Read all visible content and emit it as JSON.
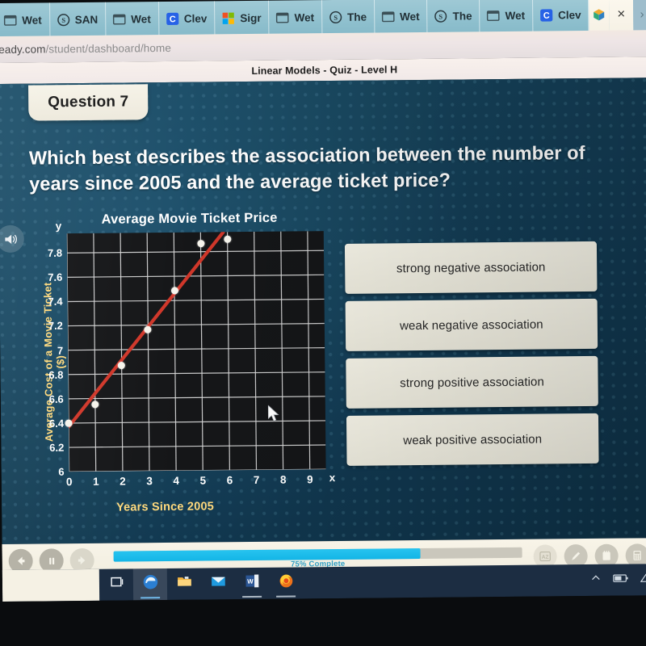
{
  "browser": {
    "tabs": [
      {
        "label": "Wet",
        "icon": "window-icon"
      },
      {
        "label": "SAN",
        "icon": "s-circle-icon"
      },
      {
        "label": "Wet",
        "icon": "window-icon"
      },
      {
        "label": "Clev",
        "icon": "clever-c-icon"
      },
      {
        "label": "Sigr",
        "icon": "microsoft-squares-icon"
      },
      {
        "label": "Wet",
        "icon": "window-icon"
      },
      {
        "label": "The",
        "icon": "s-circle-icon"
      },
      {
        "label": "Wet",
        "icon": "window-icon"
      },
      {
        "label": "The",
        "icon": "s-circle-icon"
      },
      {
        "label": "Wet",
        "icon": "window-icon"
      },
      {
        "label": "Clev",
        "icon": "clever-c-icon"
      }
    ],
    "active_tab": {
      "label": "",
      "icon": "cube-icon"
    },
    "close_label": "×",
    "scroll_right_label": "›",
    "url_prefix": "ready.com",
    "url_path": "/student/dashboard/home"
  },
  "page": {
    "title": "Linear Models - Quiz - Level H",
    "question_badge": "Question 7",
    "question_text": "Which best describes the association between the number of years since 2005 and the average ticket price?",
    "speaker_icon": "audio-speaker-icon"
  },
  "chart_data": {
    "type": "scatter",
    "title": "Average Movie Ticket Price",
    "xlabel": "Years Since 2005",
    "ylabel": "Average Cost of a Movie Ticket ($)",
    "x_axis_letter": "x",
    "y_axis_letter": "y",
    "xlim": [
      0,
      9.6
    ],
    "ylim": [
      6,
      7.96
    ],
    "xticks": [
      "0",
      "1",
      "2",
      "3",
      "4",
      "5",
      "6",
      "7",
      "8",
      "9"
    ],
    "xtick_values": [
      0,
      1,
      2,
      3,
      4,
      5,
      6,
      7,
      8,
      9
    ],
    "yticks": [
      "6",
      "6.2",
      "6.4",
      "6.6",
      "6.8",
      "7",
      "7.2",
      "7.4",
      "7.6",
      "7.8"
    ],
    "ytick_values": [
      6,
      6.2,
      6.4,
      6.6,
      6.8,
      7,
      7.2,
      7.4,
      7.6,
      7.8
    ],
    "grid": true,
    "legend": "none",
    "plot_background": "#17181a",
    "grid_color": "#d8d8d8",
    "point_color": "#f4f2ea",
    "trendline_color": "#d2372a",
    "x": [
      0,
      1,
      2,
      3,
      4,
      5,
      6
    ],
    "y": [
      6.4,
      6.55,
      6.87,
      7.16,
      7.48,
      7.87,
      7.9
    ],
    "points": [
      {
        "x": 0,
        "y": 6.4
      },
      {
        "x": 1,
        "y": 6.55
      },
      {
        "x": 2,
        "y": 6.87
      },
      {
        "x": 3,
        "y": 7.16
      },
      {
        "x": 4,
        "y": 7.48
      },
      {
        "x": 5,
        "y": 7.87
      },
      {
        "x": 6,
        "y": 7.9
      }
    ],
    "trendline": {
      "x0": 0,
      "y0": 6.37,
      "x1": 5.85,
      "y1": 7.96
    }
  },
  "answers": {
    "options": [
      {
        "label": "strong negative association"
      },
      {
        "label": "weak negative association"
      },
      {
        "label": "strong positive association"
      },
      {
        "label": "weak positive association"
      }
    ]
  },
  "toolbar": {
    "back_icon": "back-arrow-icon",
    "pause_icon": "pause-icon",
    "forward_icon": "forward-arrow-icon",
    "progress_percent": 75,
    "progress_text": "75% Complete",
    "tools": [
      {
        "icon": "glossary-az-icon",
        "enabled": false
      },
      {
        "icon": "pencil-icon",
        "enabled": true
      },
      {
        "icon": "notepad-icon",
        "enabled": true
      },
      {
        "icon": "calculator-icon",
        "enabled": true
      }
    ]
  },
  "taskbar": {
    "items": [
      {
        "icon": "task-view-icon",
        "active": false
      },
      {
        "icon": "edge-browser-icon",
        "active": true
      },
      {
        "icon": "file-explorer-icon",
        "active": false
      },
      {
        "icon": "mail-icon",
        "active": false
      },
      {
        "icon": "word-icon",
        "active": false
      },
      {
        "icon": "firefox-icon",
        "active": false
      }
    ],
    "tray": [
      {
        "icon": "chevron-up-icon"
      },
      {
        "icon": "battery-icon"
      },
      {
        "icon": "network-icon"
      }
    ]
  },
  "colors": {
    "accent_blue": "#11b5e6",
    "trendline_red": "#d2372a",
    "axis_yellow": "#ffd87a",
    "app_bg": "#16425a"
  }
}
